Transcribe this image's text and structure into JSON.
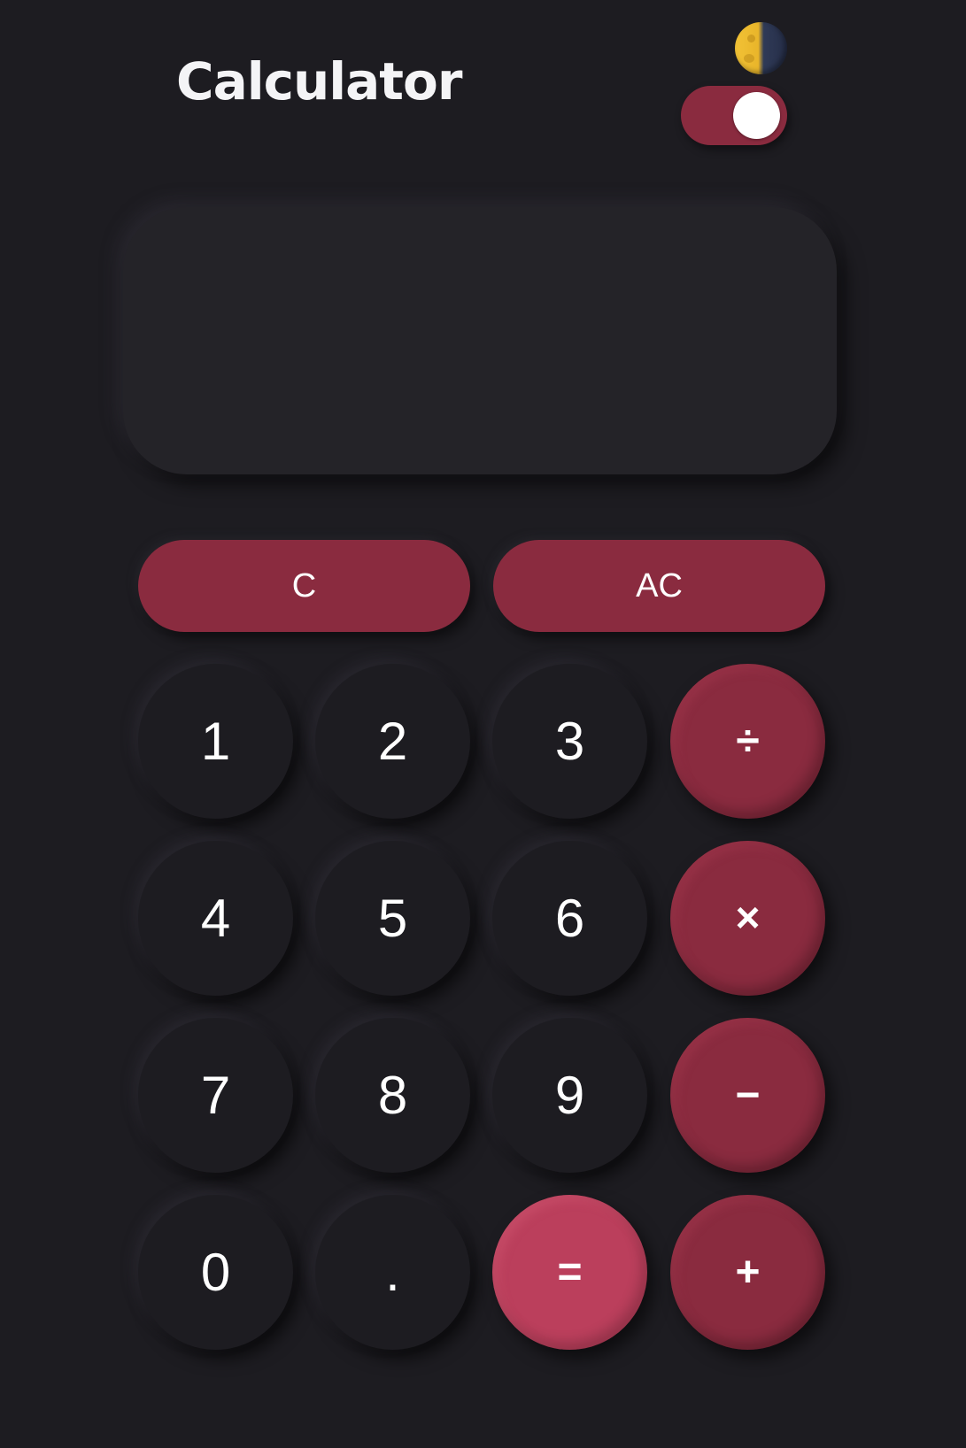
{
  "header": {
    "title": "Calculator",
    "theme_icon": "moon-icon",
    "theme_toggle_on": true
  },
  "display": {
    "value": ""
  },
  "controls": {
    "clear_label": "C",
    "all_clear_label": "AC"
  },
  "keys": {
    "one": "1",
    "two": "2",
    "three": "3",
    "divide": "÷",
    "four": "4",
    "five": "5",
    "six": "6",
    "multiply": "×",
    "seven": "7",
    "eight": "8",
    "nine": "9",
    "subtract": "−",
    "zero": "0",
    "decimal": ".",
    "equals": "=",
    "add": "+"
  },
  "colors": {
    "background": "#1d1c21",
    "accent": "#8a2b3f",
    "equals": "#bb3f5c",
    "text": "#ffffff"
  }
}
